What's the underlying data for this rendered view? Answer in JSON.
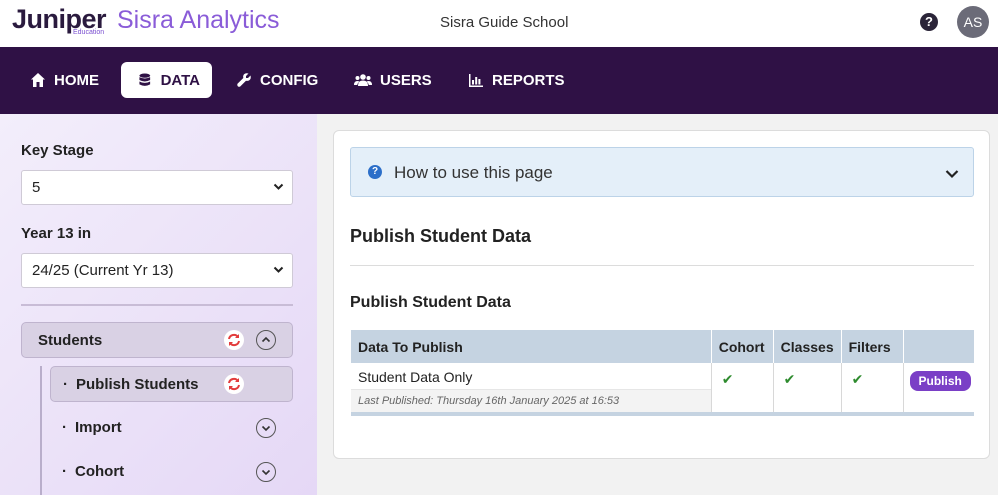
{
  "brand": {
    "juniper": "Juniper",
    "education": "Education",
    "sisra": "Sisra Analytics"
  },
  "header": {
    "school": "Sisra Guide School",
    "avatar_initials": "AS",
    "help_glyph": "?"
  },
  "nav": [
    {
      "label": "HOME",
      "icon": "home-icon",
      "active": false
    },
    {
      "label": "DATA",
      "icon": "database-icon",
      "active": true
    },
    {
      "label": "CONFIG",
      "icon": "wrench-icon",
      "active": false
    },
    {
      "label": "USERS",
      "icon": "users-icon",
      "active": false
    },
    {
      "label": "REPORTS",
      "icon": "bar-chart-icon",
      "active": false
    }
  ],
  "sidebar": {
    "key_stage_label": "Key Stage",
    "key_stage_value": "5",
    "year_label": "Year 13 in",
    "year_value": "24/25 (Current Yr 13)",
    "group_label": "Students",
    "items": [
      {
        "label": "Publish Students",
        "active": true
      },
      {
        "label": "Import",
        "active": false
      },
      {
        "label": "Cohort",
        "active": false
      }
    ]
  },
  "main": {
    "howto": "How to use this page",
    "title": "Publish Student Data",
    "section_title": "Publish Student Data",
    "table": {
      "headers": [
        "Data To Publish",
        "Cohort",
        "Classes",
        "Filters",
        ""
      ],
      "rows": [
        {
          "name": "Student Data Only",
          "last_published": "Last Published: Thursday 16th January 2025 at 16:53",
          "cohort": "✔",
          "classes": "✔",
          "filters": "✔",
          "action": "Publish"
        }
      ]
    }
  },
  "colors": {
    "nav_bg": "#2f1145",
    "brand_purple": "#8a5cd8",
    "publish_button": "#7a3fc6",
    "table_header": "#c5d3e1",
    "tick": "#2e8b2e"
  }
}
